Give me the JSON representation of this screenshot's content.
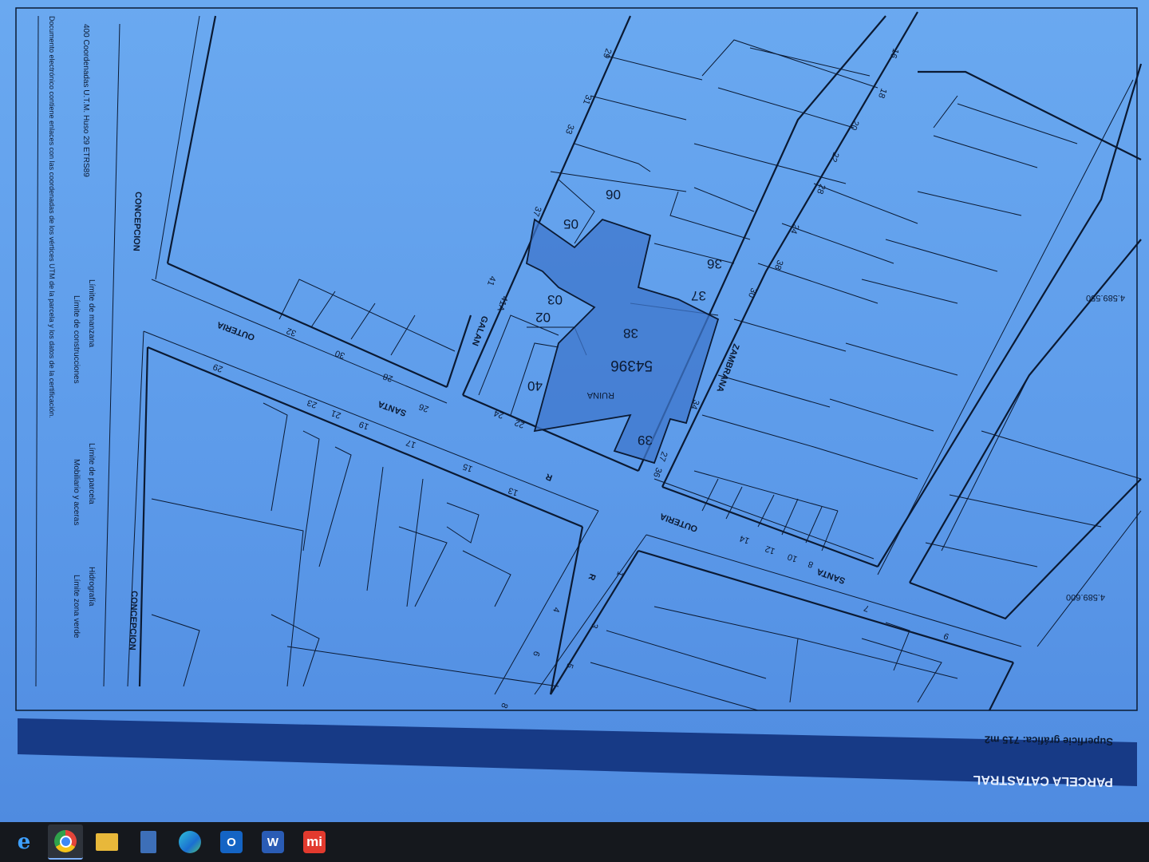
{
  "document": {
    "header_title": "PARCELA CATASTRAL",
    "surface_label": "Superficie gráfica: 715 m2",
    "parcel_ref": "54396",
    "parcel_label": "RUINA",
    "streets": {
      "santa_outeria_1": "SANTA",
      "santa_outeria_2": "OUTERIA",
      "santa_outeria_3": "SANTA",
      "santa_outeria_4": "OUTERIA",
      "r_1": "R",
      "r_2": "R",
      "galan": "GALAN",
      "zambrana": "ZAMBRANA",
      "concepcion": "CONCEPCION",
      "concepcion_2": "CONCEPCION"
    },
    "plot_numbers": [
      "05",
      "06",
      "36",
      "37",
      "38",
      "02",
      "03",
      "40",
      "39"
    ],
    "house_numbers": [
      "29",
      "23",
      "21",
      "19",
      "17",
      "15",
      "13",
      "22",
      "24",
      "26",
      "28",
      "30",
      "32",
      "41",
      "41A",
      "37",
      "33",
      "31",
      "29",
      "27",
      "36",
      "34",
      "38",
      "30",
      "28",
      "24",
      "22",
      "20",
      "18",
      "16",
      "14",
      "12",
      "10",
      "8",
      "7",
      "9",
      "6",
      "4",
      "3",
      "5",
      "1",
      "8"
    ],
    "legend": {
      "line1": "400 Coordenadas U.T.M. Huso 29 ETRS89",
      "line2": "Límite de manzana",
      "line3": "Límite de construcciones",
      "line4": "Límite de parcela",
      "line5": "Mobiliario y aceras",
      "line6": "Hidrografía",
      "line7": "Límite zona verde",
      "line8": "Documento electrónico contiene enlaces con las coordenadas de los vértices UTM de la parcela y los datos de la certificación."
    },
    "coords": {
      "c1": "4.589.600",
      "c2": "4.589.550"
    }
  },
  "taskbar": {
    "icons": [
      "internet-explorer-icon",
      "chrome-icon",
      "file-explorer-icon",
      "calculator-icon",
      "edge-icon",
      "outlook-icon",
      "word-icon",
      "mi-app-icon"
    ],
    "mi_label": "mi",
    "word_label": "W",
    "outlook_label": "O",
    "ie_label": "e"
  },
  "colors": {
    "paper": "#6aa9f0",
    "parcel_fill": "#3f77cc",
    "line": "#0b1a33",
    "header_band": "#173a86"
  }
}
